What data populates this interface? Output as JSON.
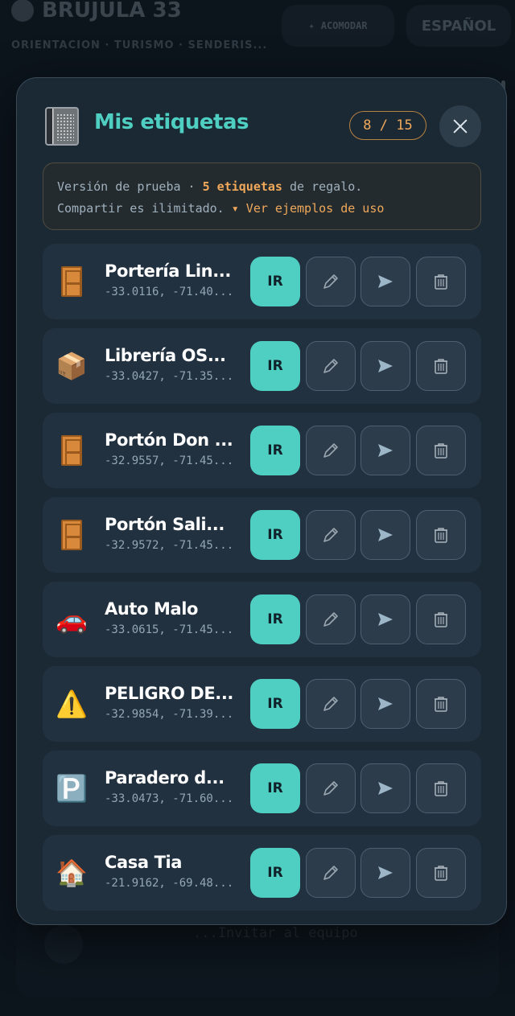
{
  "background": {
    "app_title": "BRUJULA 33",
    "app_subtitle": "ORIENTACION · TURISMO · SENDERIS...",
    "arrange_label": "ACOMODAR",
    "language_label": "ESPAÑOL",
    "bottom_text": "...Invitar al equipo"
  },
  "modal": {
    "title": "Mis etiquetas",
    "title_icon": "notebook-icon",
    "counter": "8 / 15",
    "close_icon": "close-icon",
    "notice": {
      "part1": "Versión de prueba · ",
      "highlight": "5 etiquetas",
      "part2": " de regalo.",
      "line2": "Compartir es ilimitado.",
      "link": "▾ Ver ejemplos de uso"
    },
    "button_labels": {
      "go": "IR",
      "edit_icon": "pencil-icon",
      "send_icon": "send-icon",
      "delete_icon": "trash-icon"
    },
    "items": [
      {
        "emoji": "door",
        "name": "Portería Lin...",
        "coords": "-33.0116, -71.40..."
      },
      {
        "emoji": "📦",
        "name": "Librería OS...",
        "coords": "-33.0427, -71.35..."
      },
      {
        "emoji": "door",
        "name": "Portón Don ...",
        "coords": "-32.9557, -71.45..."
      },
      {
        "emoji": "door",
        "name": "Portón Sali...",
        "coords": "-32.9572, -71.45..."
      },
      {
        "emoji": "🚗",
        "name": "Auto Malo",
        "coords": "-33.0615, -71.45..."
      },
      {
        "emoji": "⚠️",
        "name": "PELIGRO DE...",
        "coords": "-32.9854, -71.39..."
      },
      {
        "emoji": "🅿️",
        "name": "Paradero d...",
        "coords": "-33.0473, -71.60..."
      },
      {
        "emoji": "🏠",
        "name": "Casa Tia",
        "coords": "-21.9162, -69.48..."
      }
    ]
  },
  "colors": {
    "accent": "#4fcfc2",
    "warning": "#f0a85a",
    "panel": "#1b2935",
    "row": "#223140"
  }
}
